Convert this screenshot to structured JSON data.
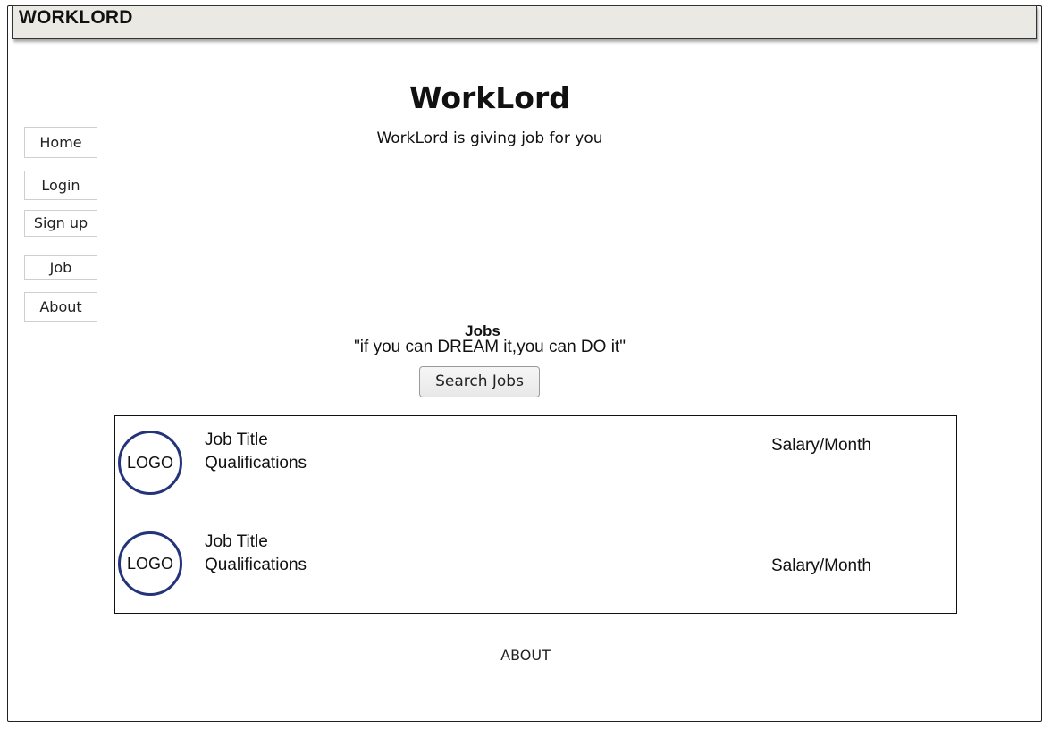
{
  "app": {
    "brand": "WORKLORD"
  },
  "hero": {
    "title": "WorkLord",
    "subtitle": "WorkLord is giving job for you"
  },
  "nav": [
    {
      "label": "Home"
    },
    {
      "label": "Login"
    },
    {
      "label": "Sign up"
    },
    {
      "label": "Job"
    },
    {
      "label": "About"
    }
  ],
  "jobs": {
    "heading": "Jobs",
    "quote": "\"if you can DREAM it,you can DO it\"",
    "search_label": "Search Jobs",
    "items": [
      {
        "logo": "LOGO",
        "title": "Job Title",
        "qualifications": "Qualifications",
        "salary": "Salary/Month"
      },
      {
        "logo": "LOGO",
        "title": "Job Title",
        "qualifications": "Qualifications",
        "salary": "Salary/Month"
      }
    ]
  },
  "footer": {
    "about": "ABOUT"
  },
  "colors": {
    "titlebar": "#ebe9e3",
    "logo_ring": "#23347a"
  }
}
